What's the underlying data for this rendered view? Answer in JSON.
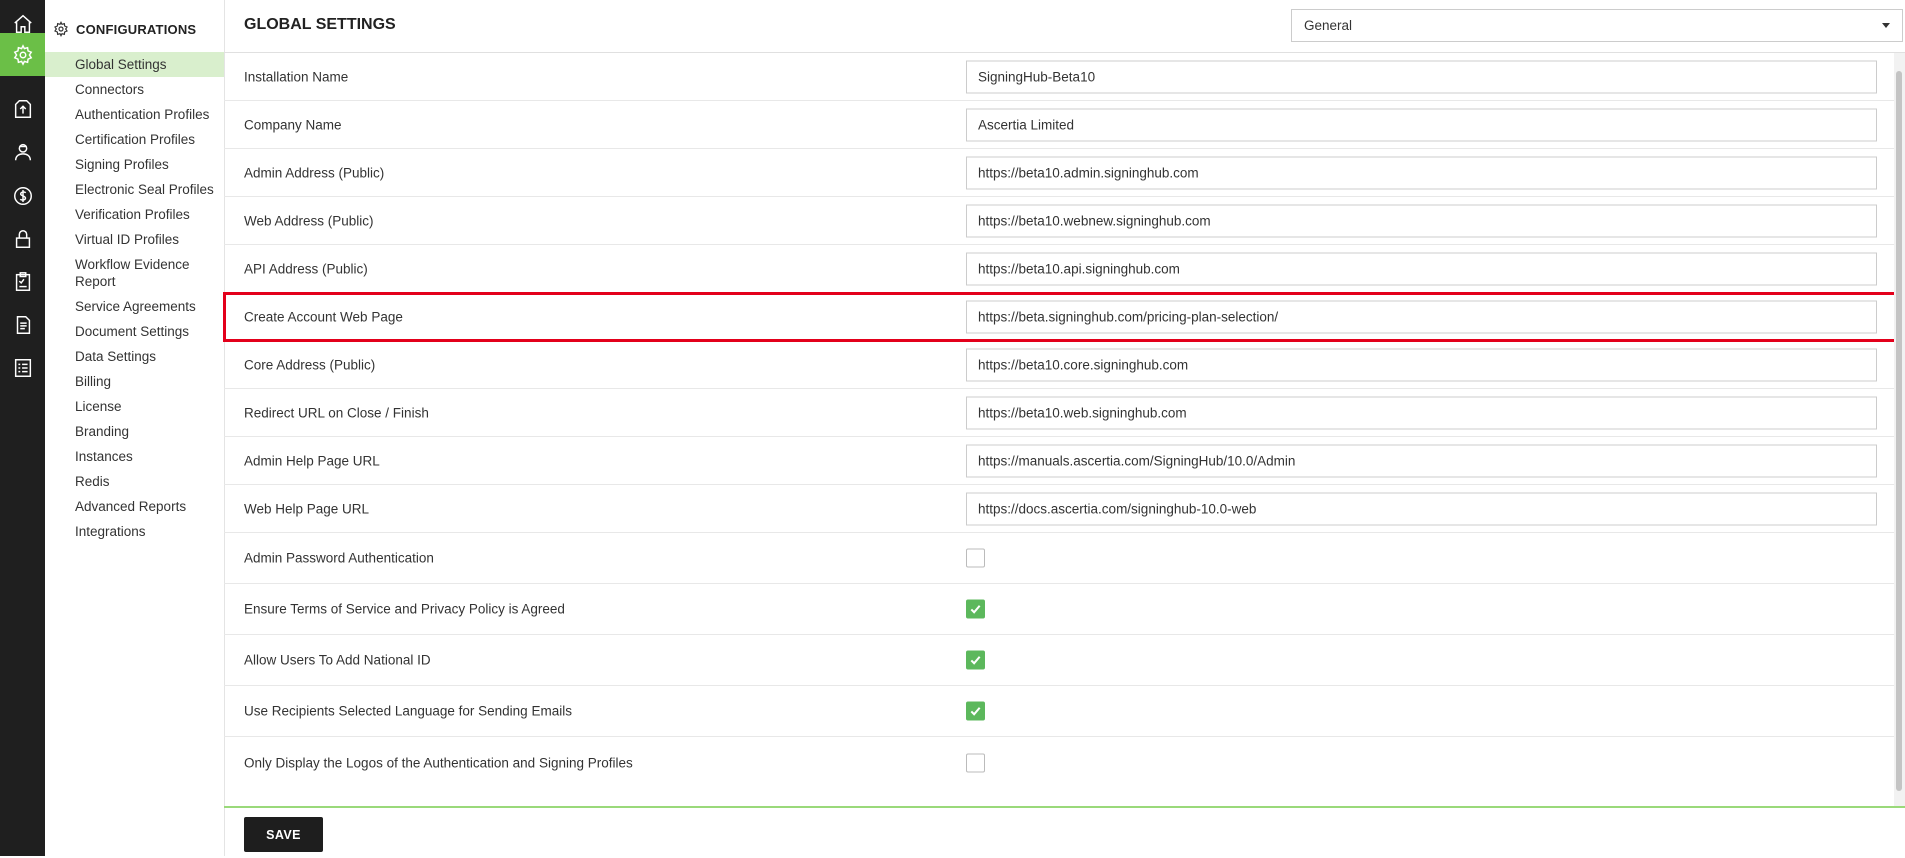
{
  "rail": {
    "items": [
      {
        "icon": "home-icon"
      },
      {
        "icon": "gear-icon",
        "active": true
      },
      {
        "icon": "upload-icon"
      },
      {
        "icon": "user-icon"
      },
      {
        "icon": "dollar-icon"
      },
      {
        "icon": "lock-icon"
      },
      {
        "icon": "clipboard-icon"
      },
      {
        "icon": "document-icon"
      },
      {
        "icon": "report-icon"
      }
    ]
  },
  "sidebar": {
    "title": "CONFIGURATIONS",
    "items": [
      {
        "label": "Global Settings",
        "active": true
      },
      {
        "label": "Connectors"
      },
      {
        "label": "Authentication Profiles"
      },
      {
        "label": "Certification Profiles"
      },
      {
        "label": "Signing Profiles"
      },
      {
        "label": "Electronic Seal Profiles"
      },
      {
        "label": "Verification Profiles"
      },
      {
        "label": "Virtual ID Profiles"
      },
      {
        "label": "Workflow Evidence Report"
      },
      {
        "label": "Service Agreements"
      },
      {
        "label": "Document Settings"
      },
      {
        "label": "Data Settings"
      },
      {
        "label": "Billing"
      },
      {
        "label": "License"
      },
      {
        "label": "Branding"
      },
      {
        "label": "Instances"
      },
      {
        "label": "Redis"
      },
      {
        "label": "Advanced Reports"
      },
      {
        "label": "Integrations"
      }
    ]
  },
  "header": {
    "title": "GLOBAL SETTINGS",
    "category_select": {
      "value": "General"
    }
  },
  "settings": {
    "text_fields": [
      {
        "label": "Installation Name",
        "value": "SigningHub-Beta10"
      },
      {
        "label": "Company Name",
        "value": "Ascertia Limited"
      },
      {
        "label": "Admin Address (Public)",
        "value": "https://beta10.admin.signinghub.com"
      },
      {
        "label": "Web Address (Public)",
        "value": "https://beta10.webnew.signinghub.com"
      },
      {
        "label": "API Address (Public)",
        "value": "https://beta10.api.signinghub.com"
      },
      {
        "label": "Create Account Web Page",
        "value": "https://beta.signinghub.com/pricing-plan-selection/",
        "highlighted": true
      },
      {
        "label": "Core Address (Public)",
        "value": "https://beta10.core.signinghub.com"
      },
      {
        "label": "Redirect URL on Close / Finish",
        "value": "https://beta10.web.signinghub.com"
      },
      {
        "label": "Admin Help Page URL",
        "value": "https://manuals.ascertia.com/SigningHub/10.0/Admin"
      },
      {
        "label": "Web Help Page URL",
        "value": "https://docs.ascertia.com/signinghub-10.0-web"
      }
    ],
    "checkboxes": [
      {
        "label": "Admin Password Authentication",
        "checked": false
      },
      {
        "label": "Ensure Terms of Service and Privacy Policy is Agreed",
        "checked": true
      },
      {
        "label": "Allow Users To Add National ID",
        "checked": true
      },
      {
        "label": "Use Recipients Selected Language for Sending Emails",
        "checked": true
      },
      {
        "label": "Only Display the Logos of the Authentication and Signing Profiles",
        "checked": false
      }
    ]
  },
  "footer": {
    "save_label": "SAVE"
  },
  "colors": {
    "accent_green": "#6bbf47",
    "rail_bg": "#1f1f1f",
    "highlight_red": "#e3001b",
    "checkbox_green": "#5cb85c"
  }
}
